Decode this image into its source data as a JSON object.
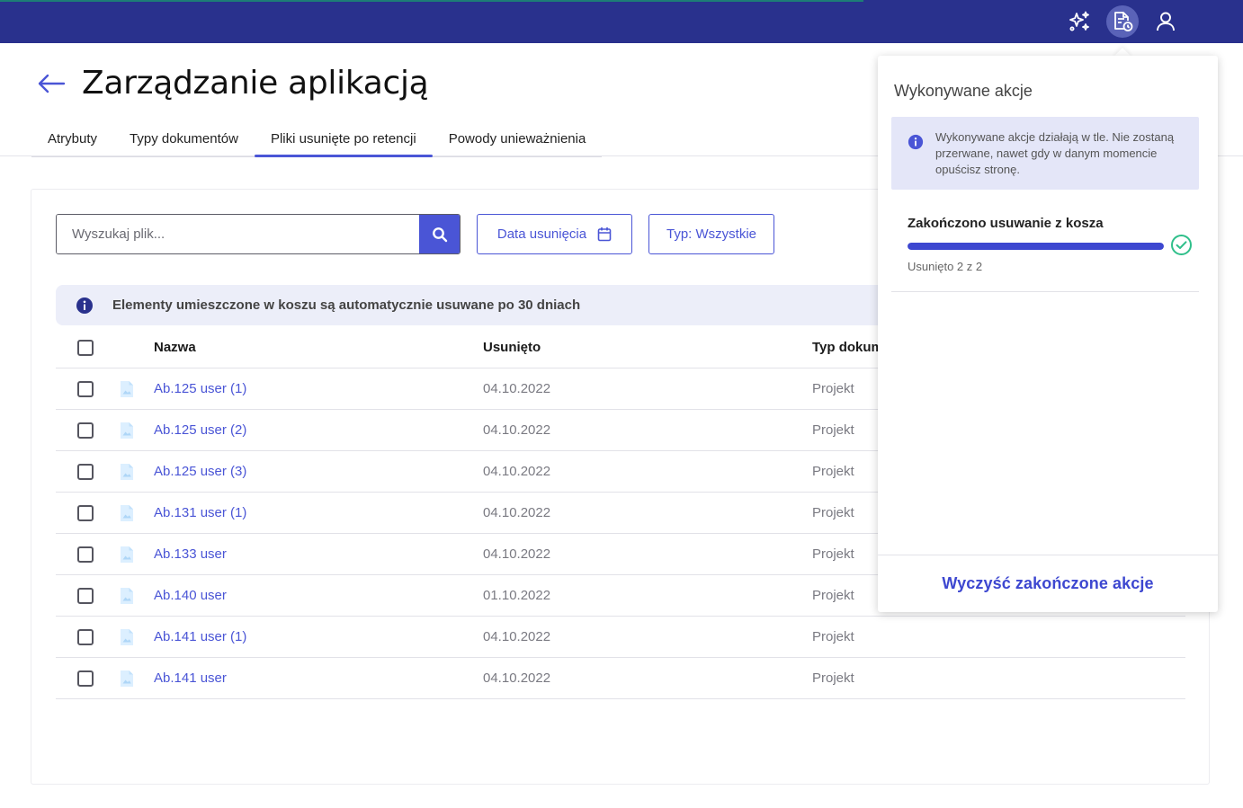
{
  "topbar": {
    "icons": [
      "sparkles-icon",
      "document-clock-icon",
      "user-icon"
    ],
    "colors": {
      "background": "#29318d",
      "active_icon_bg": "#5a63b8"
    }
  },
  "header": {
    "title": "Zarządzanie aplikacją",
    "back_icon": "arrow-left-icon"
  },
  "tabs": [
    {
      "label": "Atrybuty"
    },
    {
      "label": "Typy dokumentów"
    },
    {
      "label": "Pliki usunięte po retencji",
      "active": true
    },
    {
      "label": "Powody unieważnienia"
    }
  ],
  "toolbar": {
    "search_placeholder": "Wyszukaj plik...",
    "date_filter_label": "Data usunięcia",
    "type_filter_label": "Typ: Wszystkie"
  },
  "info_banner": {
    "text": "Elementy umieszczone w koszu są automatycznie usuwane po 30 dniach"
  },
  "table": {
    "columns": [
      "Nazwa",
      "Usunięto",
      "Typ dokum"
    ],
    "rows": [
      {
        "name": "Ab.125 user (1)",
        "deleted": "04.10.2022",
        "type": "Projekt"
      },
      {
        "name": "Ab.125 user (2)",
        "deleted": "04.10.2022",
        "type": "Projekt"
      },
      {
        "name": "Ab.125 user (3)",
        "deleted": "04.10.2022",
        "type": "Projekt"
      },
      {
        "name": "Ab.131 user (1)",
        "deleted": "04.10.2022",
        "type": "Projekt"
      },
      {
        "name": "Ab.133 user",
        "deleted": "04.10.2022",
        "type": "Projekt"
      },
      {
        "name": "Ab.140 user",
        "deleted": "01.10.2022",
        "type": "Projekt"
      },
      {
        "name": "Ab.141 user (1)",
        "deleted": "04.10.2022",
        "type": "Projekt"
      },
      {
        "name": "Ab.141 user",
        "deleted": "04.10.2022",
        "type": "Projekt"
      }
    ]
  },
  "actions_panel": {
    "title": "Wykonywane akcje",
    "info_text": "Wykonywane akcje działają w tle. Nie zostaną przerwane, nawet gdy w danym momencie opuścisz stronę.",
    "task": {
      "title": "Zakończono usuwanie z kosza",
      "status": "Usunięto 2 z 2",
      "progress": 1.0
    },
    "clear_label": "Wyczyść zakończone akcje"
  },
  "colors": {
    "accent": "#4a55d6",
    "success": "#2fbf8a"
  }
}
